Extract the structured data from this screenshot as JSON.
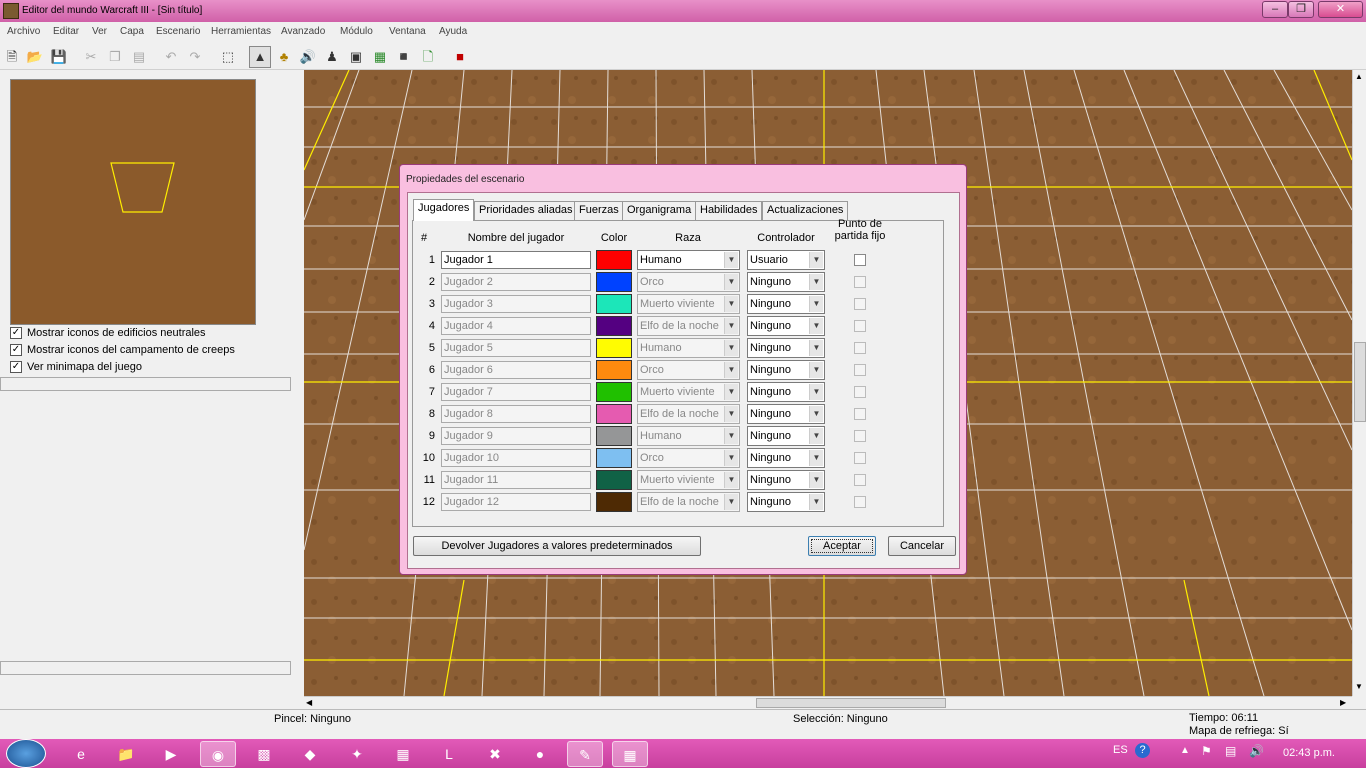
{
  "window": {
    "title": "Editor del mundo Warcraft III  - [Sin título]"
  },
  "menu": [
    "Archivo",
    "Editar",
    "Ver",
    "Capa",
    "Escenario",
    "Herramientas",
    "Avanzado",
    "Módulo",
    "Ventana",
    "Ayuda"
  ],
  "left_panel": {
    "options": [
      {
        "label": "Mostrar iconos de edificios neutrales",
        "checked": true
      },
      {
        "label": "Mostrar iconos del campamento de creeps",
        "checked": true
      },
      {
        "label": "Ver minimapa del juego",
        "checked": true
      }
    ]
  },
  "status": {
    "brush": "Pincel: Ninguno",
    "selection": "Selección: Ninguno",
    "time": "Tiempo: 06:11",
    "refresh_map": "Mapa de refriega: Sí"
  },
  "dialog": {
    "title": "Propiedades del escenario",
    "tabs": [
      "Jugadores",
      "Prioridades aliadas",
      "Fuerzas",
      "Organigrama",
      "Habilidades",
      "Actualizaciones"
    ],
    "active_tab": "Jugadores",
    "headers": {
      "num": "#",
      "name": "Nombre del jugador",
      "color": "Color",
      "race": "Raza",
      "controller": "Controlador",
      "fixed_start": "Punto de partida fijo"
    },
    "players": [
      {
        "num": "1",
        "name": "Jugador 1",
        "color": "#ff0000",
        "race": "Humano",
        "controller": "Usuario",
        "enabled": true
      },
      {
        "num": "2",
        "name": "Jugador 2",
        "color": "#0042ff",
        "race": "Orco",
        "controller": "Ninguno",
        "enabled": false
      },
      {
        "num": "3",
        "name": "Jugador 3",
        "color": "#1ce6b9",
        "race": "Muerto viviente",
        "controller": "Ninguno",
        "enabled": false
      },
      {
        "num": "4",
        "name": "Jugador 4",
        "color": "#540081",
        "race": "Elfo de la noche",
        "controller": "Ninguno",
        "enabled": false
      },
      {
        "num": "5",
        "name": "Jugador 5",
        "color": "#fffc01",
        "race": "Humano",
        "controller": "Ninguno",
        "enabled": false
      },
      {
        "num": "6",
        "name": "Jugador 6",
        "color": "#fe8a0e",
        "race": "Orco",
        "controller": "Ninguno",
        "enabled": false
      },
      {
        "num": "7",
        "name": "Jugador 7",
        "color": "#20c000",
        "race": "Muerto viviente",
        "controller": "Ninguno",
        "enabled": false
      },
      {
        "num": "8",
        "name": "Jugador 8",
        "color": "#e55bb0",
        "race": "Elfo de la noche",
        "controller": "Ninguno",
        "enabled": false
      },
      {
        "num": "9",
        "name": "Jugador 9",
        "color": "#959697",
        "race": "Humano",
        "controller": "Ninguno",
        "enabled": false
      },
      {
        "num": "10",
        "name": "Jugador 10",
        "color": "#7ebff1",
        "race": "Orco",
        "controller": "Ninguno",
        "enabled": false
      },
      {
        "num": "11",
        "name": "Jugador 11",
        "color": "#106246",
        "race": "Muerto viviente",
        "controller": "Ninguno",
        "enabled": false
      },
      {
        "num": "12",
        "name": "Jugador 12",
        "color": "#4e2a04",
        "race": "Elfo de la noche",
        "controller": "Ninguno",
        "enabled": false
      }
    ],
    "reset_button": "Devolver Jugadores a valores predeterminados",
    "ok_button": "Aceptar",
    "cancel_button": "Cancelar"
  },
  "taskbar": {
    "language": "ES",
    "clock": "02:43 p.m."
  }
}
